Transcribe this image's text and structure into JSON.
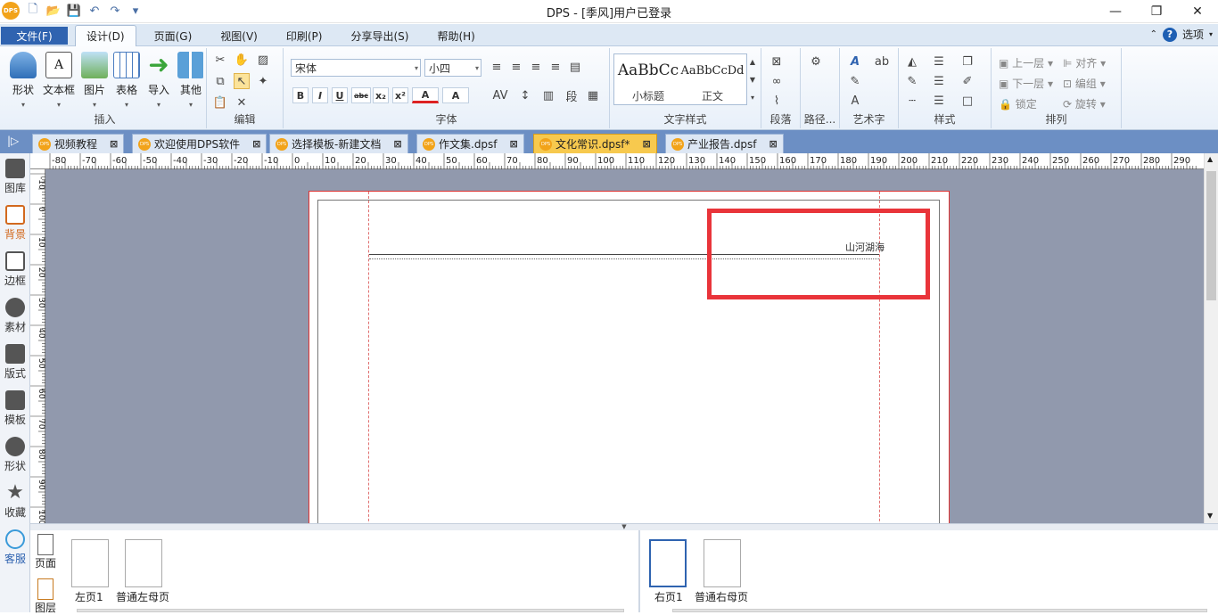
{
  "app": {
    "title": "DPS - [季风]用户已登录",
    "logo_text": "DPS",
    "window_controls": [
      "—",
      "❐",
      "✕"
    ]
  },
  "menu": {
    "file_label": "文件(F)",
    "tabs": [
      "设计(D)",
      "页面(G)",
      "视图(V)",
      "印刷(P)",
      "分享导出(S)",
      "帮助(H)"
    ],
    "active_tab": "设计(D)",
    "options_label": "选项"
  },
  "ribbon": {
    "insert": {
      "label": "插入",
      "buttons": [
        "形状",
        "文本框",
        "图片",
        "表格",
        "导入",
        "其他"
      ]
    },
    "edit": {
      "label": "编辑"
    },
    "font": {
      "label": "字体",
      "font_name": "宋体",
      "font_size": "小四",
      "buttons": [
        "B",
        "I",
        "U",
        "abc",
        "x₂",
        "x²",
        "A",
        "A"
      ]
    },
    "text_style": {
      "label": "文字样式",
      "styles": [
        {
          "sample": "AaBbCc",
          "name": "小标题"
        },
        {
          "sample": "AaBbCcDd",
          "name": "正文"
        }
      ]
    },
    "paragraph": {
      "label": "段落"
    },
    "path": {
      "label": "路径..."
    },
    "art_text": {
      "label": "艺术字"
    },
    "style": {
      "label": "样式"
    },
    "arrange": {
      "label": "排列",
      "items": [
        "上一层",
        "对齐",
        "下一层",
        "编组",
        "锁定",
        "旋转"
      ]
    }
  },
  "doc_tabs": [
    {
      "label": "视频教程",
      "active": false
    },
    {
      "label": "欢迎使用DPS软件",
      "active": false
    },
    {
      "label": "选择模板-新建文档",
      "active": false
    },
    {
      "label": "作文集.dpsf",
      "active": false
    },
    {
      "label": "文化常识.dpsf*",
      "active": true
    },
    {
      "label": "产业报告.dpsf",
      "active": false
    }
  ],
  "left_tools": [
    "图库",
    "背景",
    "边框",
    "素材",
    "版式",
    "模板",
    "形状",
    "收藏",
    "客服"
  ],
  "ruler": {
    "h_labels": [
      "-80",
      "-70",
      "-60",
      "-50",
      "-40",
      "-30",
      "-20",
      "-10",
      "0",
      "10",
      "20",
      "30",
      "40",
      "50",
      "60",
      "70",
      "80",
      "90",
      "100",
      "110",
      "120",
      "130",
      "140",
      "150",
      "160",
      "170",
      "180",
      "190",
      "200",
      "210",
      "220",
      "230",
      "240",
      "250",
      "260",
      "270",
      "280",
      "290"
    ],
    "v_labels": [
      "-10",
      "0",
      "10",
      "20",
      "30",
      "40",
      "50",
      "60",
      "70",
      "80",
      "90",
      "100"
    ]
  },
  "page": {
    "header_text": "山河湖海"
  },
  "bottom": {
    "left_tools": [
      "页面",
      "图层"
    ],
    "left_thumbs": [
      "左页1",
      "普通左母页"
    ],
    "right_thumbs": [
      "右页1",
      "普通右母页"
    ]
  },
  "colors": {
    "accent": "#2f63b0",
    "tab_active": "#f7c94e",
    "highlight_box": "#e9343a",
    "canvas_bg": "#9199ad"
  }
}
